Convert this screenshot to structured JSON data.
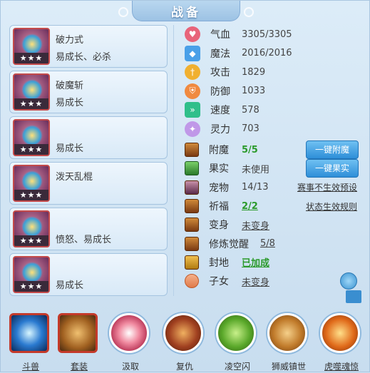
{
  "title": "战备",
  "equipment": [
    {
      "name": "破力式",
      "desc": "易成长、必杀",
      "stars": "★★★"
    },
    {
      "name": "破魔斩",
      "desc": "易成长",
      "stars": "★★★"
    },
    {
      "name": "",
      "desc": "易成长",
      "stars": "★★★"
    },
    {
      "name": "泼天乱棍",
      "desc": "",
      "stars": "★★★"
    },
    {
      "name": "",
      "desc": "愤怒、易成长",
      "stars": "★★★"
    },
    {
      "name": "",
      "desc": "易成长",
      "stars": "★★★"
    }
  ],
  "stats": [
    {
      "label": "气血",
      "value": "3305/3305",
      "icon": "heart-icon",
      "color": "#e8647a"
    },
    {
      "label": "魔法",
      "value": "2016/2016",
      "icon": "mana-icon",
      "color": "#4aa0e8"
    },
    {
      "label": "攻击",
      "value": "1829",
      "icon": "attack-icon",
      "color": "#f0b030"
    },
    {
      "label": "防御",
      "value": "1033",
      "icon": "defense-icon",
      "color": "#f08a40"
    },
    {
      "label": "速度",
      "value": "578",
      "icon": "speed-icon",
      "color": "#2fbf8a"
    },
    {
      "label": "灵力",
      "value": "703",
      "icon": "spirit-icon",
      "color": "#c098e8"
    }
  ],
  "secondary": [
    {
      "label": "附魔",
      "value": "5/5",
      "value_style": "green"
    },
    {
      "label": "果实",
      "value": "未使用",
      "value_style": ""
    },
    {
      "label": "宠物",
      "value": "14/13",
      "value_style": ""
    },
    {
      "label": "祈福",
      "value": "2/2",
      "value_style": "green-u"
    },
    {
      "label": "变身",
      "value": "未变身",
      "value_style": "u"
    },
    {
      "label": "修炼觉醒",
      "value": "5/8",
      "value_style": "u"
    },
    {
      "label": "封地",
      "value": "已加成",
      "value_style": "green-u"
    },
    {
      "label": "子女",
      "value": "未变身",
      "value_style": "u"
    }
  ],
  "buttons": {
    "enchant": "一键附魔",
    "fruit": "一键果实"
  },
  "links": {
    "pet_notice": "赛事不生效预设",
    "bless_rule": "状态生效规则"
  },
  "bottom": [
    {
      "label": "斗兽",
      "shape": "sq"
    },
    {
      "label": "套装",
      "shape": "sq"
    },
    {
      "label": "汲取",
      "shape": "circ"
    },
    {
      "label": "复仇",
      "shape": "circ"
    },
    {
      "label": "凌空闪",
      "shape": "circ"
    },
    {
      "label": "狮威镇世",
      "shape": "circ"
    },
    {
      "label": "虎噬魂惊",
      "shape": "circ"
    }
  ]
}
